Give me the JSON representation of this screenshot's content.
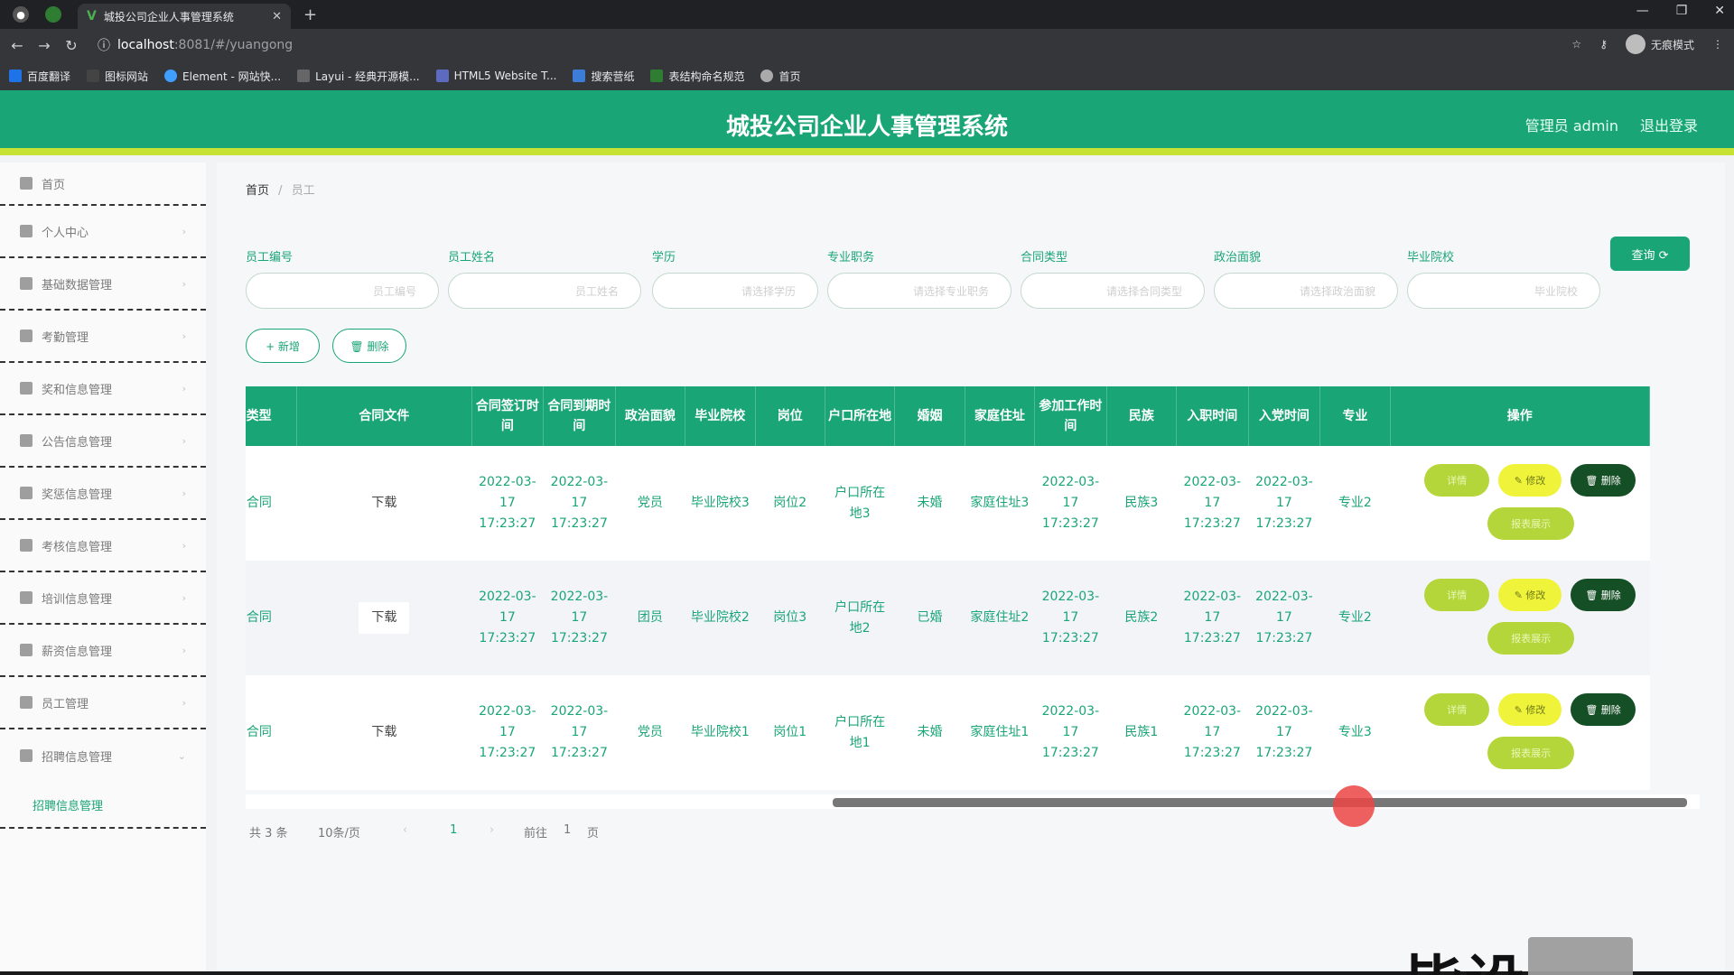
{
  "browser": {
    "tab_title": "城投公司企业人事管理系统",
    "url_host": "localhost",
    "url_path": ":8081/#/yuangong",
    "incognito_label": "无痕模式",
    "bookmarks": [
      "百度翻译",
      "图标网站",
      "Element - 网站快...",
      "Layui - 经典开源模...",
      "HTML5 Website T...",
      "搜索营纸",
      "表结构命名规范",
      "首页"
    ]
  },
  "header": {
    "title": "城投公司企业人事管理系统",
    "admin": "管理员 admin",
    "logout": "退出登录"
  },
  "sidebar": {
    "items": [
      {
        "label": "首页",
        "icon": "home-icon"
      },
      {
        "label": "个人中心",
        "icon": "user-icon"
      },
      {
        "label": "基础数据管理",
        "icon": "data-icon"
      },
      {
        "label": "考勤管理",
        "icon": "attendance-icon"
      },
      {
        "label": "奖和信息管理",
        "icon": "reward-icon"
      },
      {
        "label": "公告信息管理",
        "icon": "notice-icon"
      },
      {
        "label": "奖惩信息管理",
        "icon": "list-icon"
      },
      {
        "label": "考核信息管理",
        "icon": "assess-icon"
      },
      {
        "label": "培训信息管理",
        "icon": "training-icon"
      },
      {
        "label": "薪资信息管理",
        "icon": "salary-icon"
      },
      {
        "label": "员工管理",
        "icon": "staff-icon"
      },
      {
        "label": "招聘信息管理",
        "icon": "recruit-icon"
      }
    ],
    "sub_item": "招聘信息管理"
  },
  "breadcrumb": {
    "home": "首页",
    "sep": "/",
    "current": "员工"
  },
  "filters": {
    "labels": [
      "员工编号",
      "员工姓名",
      "学历",
      "专业职务",
      "合同类型",
      "政治面貌",
      "毕业院校"
    ],
    "placeholders": [
      "员工编号",
      "员工姓名",
      "请选择学历",
      "请选择专业职务",
      "请选择合同类型",
      "请选择政治面貌",
      "毕业院校"
    ],
    "query": "查询 ⟳"
  },
  "actions": {
    "add": "+ 新增",
    "delete": "🗑 删除"
  },
  "table": {
    "headers": [
      "合同类型",
      "合同文件",
      "合同签订时间",
      "合同到期时间",
      "政治面貌",
      "毕业院校",
      "岗位",
      "户口所在地",
      "婚姻",
      "家庭住址",
      "参加工作时间",
      "民族",
      "入职时间",
      "入党时间",
      "专业",
      "操作"
    ],
    "rows": [
      [
        "短期合同",
        "下载",
        "2022-03-17 17:23:27",
        "2022-03-17 17:23:27",
        "党员",
        "毕业院校3",
        "岗位2",
        "户口所在地3",
        "未婚",
        "家庭住址3",
        "2022-03-17 17:23:27",
        "民族3",
        "2022-03-17 17:23:27",
        "2022-03-17 17:23:27",
        "专业2"
      ],
      [
        "长期合同",
        "下载",
        "2022-03-17 17:23:27",
        "2022-03-17 17:23:27",
        "团员",
        "毕业院校2",
        "岗位3",
        "户口所在地2",
        "已婚",
        "家庭住址2",
        "2022-03-17 17:23:27",
        "民族2",
        "2022-03-17 17:23:27",
        "2022-03-17 17:23:27",
        "专业2"
      ],
      [
        "长期合同",
        "下载",
        "2022-03-17 17:23:27",
        "2022-03-17 17:23:27",
        "党员",
        "毕业院校1",
        "岗位1",
        "户口所在地1",
        "未婚",
        "家庭住址1",
        "2022-03-17 17:23:27",
        "民族1",
        "2022-03-17 17:23:27",
        "2022-03-17 17:23:27",
        "专业3"
      ]
    ],
    "op_labels": {
      "detail": "详情",
      "edit": "✎ 修改",
      "delete": "🗑 删除",
      "report": "报表展示"
    }
  },
  "pager": {
    "total": "共 3 条",
    "size": "10条/页",
    "page": "1",
    "goto": "前往",
    "goto_page": "1",
    "unit": "页"
  },
  "watermark": "毕设",
  "colors": {
    "primary": "#1aa577",
    "accent_bar": "#c7e234",
    "delete": "#154f25",
    "edit": "#eff33a"
  }
}
